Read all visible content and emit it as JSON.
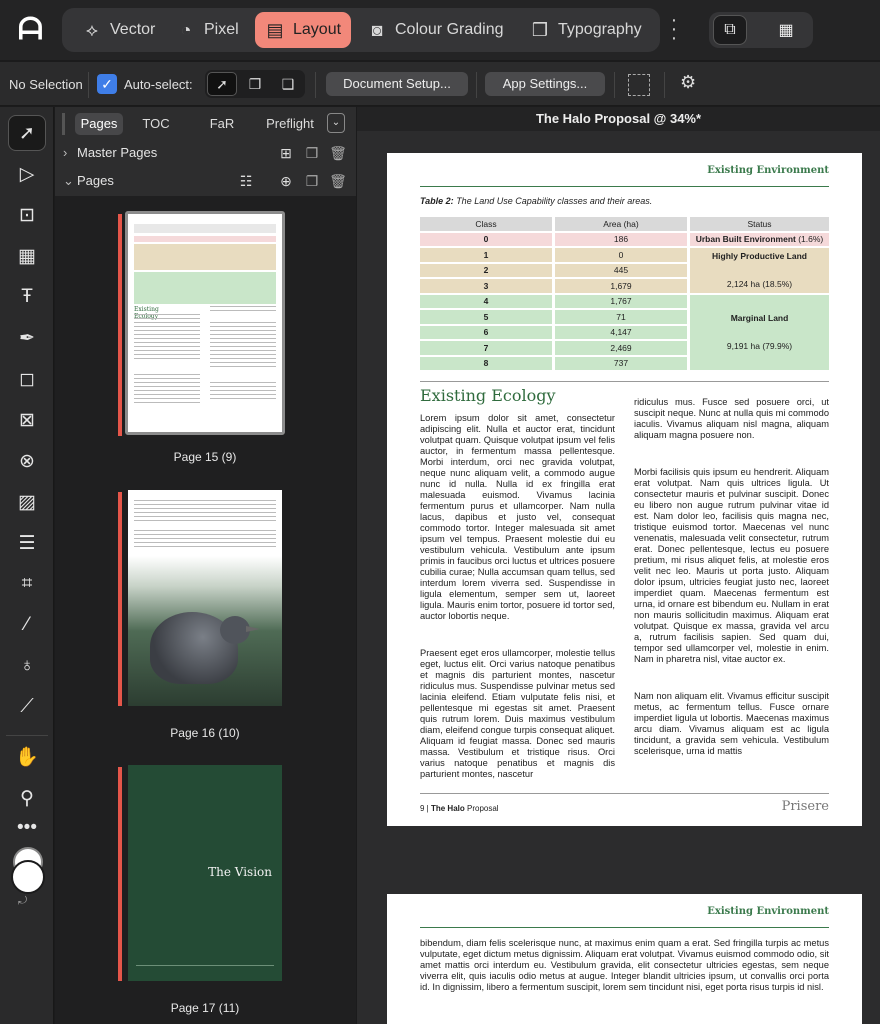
{
  "app": {
    "logo": "affinity-logo"
  },
  "personas": [
    "Vector",
    "Pixel",
    "Layout",
    "Colour Grading",
    "Typography"
  ],
  "context": {
    "selection": "No Selection",
    "auto_select": "Auto-select:",
    "document_setup": "Document Setup...",
    "app_settings": "App Settings..."
  },
  "panel": {
    "tabs": [
      "Pages",
      "TOC",
      "FaR",
      "Preflight"
    ],
    "master_pages": "Master Pages",
    "pages": "Pages",
    "thumbs": [
      {
        "label": "Page 15 (9)"
      },
      {
        "label": "Page 16 (10)"
      },
      {
        "label": "Page 17 (11)",
        "cover_title": "The Vision"
      }
    ]
  },
  "document": {
    "title": "The Halo Proposal @ 34%*",
    "header": "Existing Environment",
    "caption_bold": "Table 2:",
    "caption": " The Land Use Capability classes and their areas.",
    "table": {
      "headers": [
        "Class",
        "Area (ha)",
        "Status"
      ],
      "rows": [
        {
          "class": "0",
          "area": "186"
        },
        {
          "class": "1",
          "area": "0"
        },
        {
          "class": "2",
          "area": "445"
        },
        {
          "class": "3",
          "area": "1,679"
        },
        {
          "class": "4",
          "area": "1,767"
        },
        {
          "class": "5",
          "area": "71"
        },
        {
          "class": "6",
          "area": "4,147"
        },
        {
          "class": "7",
          "area": "2,469"
        },
        {
          "class": "8",
          "area": "737"
        }
      ],
      "status_urban": "Urban Built Environment",
      "status_urban_pct": " (1.6%)",
      "status_hp": "Highly Productive Land",
      "status_hp_area": "2,124 ha (18.5%)",
      "status_marginal": "Marginal Land",
      "status_marginal_area": "9,191 ha (79.9%)"
    },
    "section_title": "Existing Ecology",
    "col1_p1": "Lorem ipsum dolor sit amet, consectetur adipiscing elit. Nulla et auctor erat, tincidunt volutpat quam. Quisque volutpat ipsum vel felis auctor, in fermentum massa pellentesque. Morbi interdum, orci nec gravida volutpat, neque nunc aliquam velit, a commodo augue nunc id nulla. Nulla id ex fringilla erat malesuada euismod. Vivamus lacinia fermentum purus et ullamcorper. Nam nulla lacus, dapibus et justo vel, consequat commodo tortor. Integer malesuada sit amet ipsum vel tempus. Praesent molestie dui eu vestibulum vehicula. Vestibulum ante ipsum primis in faucibus orci luctus et ultrices posuere cubilia curae; Nulla accumsan quam tellus, sed interdum lorem viverra sed. Suspendisse in ligula elementum, semper sem ut, laoreet ligula. Mauris enim tortor, posuere id tortor sed, auctor lobortis neque.",
    "col1_p2": "Praesent eget eros ullamcorper, molestie tellus eget, luctus elit. Orci varius natoque penatibus et magnis dis parturient montes, nascetur ridiculus mus. Suspendisse pulvinar metus sed lacinia eleifend. Etiam vulputate felis nisi, et pellentesque mi egestas sit amet. Praesent quis rutrum lorem. Duis maximus vestibulum diam, eleifend congue turpis consequat aliquet. Aliquam id feugiat massa. Donec sed mauris massa. Vestibulum et tristique risus. Orci varius natoque penatibus et magnis dis parturient montes, nascetur",
    "col2_p1": "ridiculus mus. Fusce sed posuere orci, ut suscipit neque. Nunc at nulla quis mi commodo iaculis. Vivamus aliquam nisl magna, aliquam aliquam magna posuere non.",
    "col2_p2": "Morbi facilisis quis ipsum eu hendrerit. Aliquam erat volutpat. Nam quis ultrices ligula. Ut consectetur mauris et pulvinar suscipit. Donec eu libero non augue rutrum pulvinar vitae id est. Nam dolor leo, facilisis quis magna nec, tristique euismod tortor. Maecenas vel nunc venenatis, malesuada velit consectetur, rutrum erat. Donec pellentesque, lectus eu posuere pretium, mi risus aliquet felis, at molestie eros velit nec leo. Mauris ut porta justo. Aliquam dolor ipsum, ultricies feugiat justo nec, laoreet imperdiet quam. Maecenas fermentum est urna, id ornare est bibendum eu. Nullam in erat non mauris sollicitudin maximus. Aliquam erat volutpat. Quisque ex massa, gravida vel arcu a, rutrum facilisis sapien. Sed quam dui, tempor sed ullamcorper vel, molestie in enim. Nam in pharetra nisl, vitae auctor ex.",
    "col2_p3": "Nam non aliquam elit. Vivamus efficitur suscipit metus, ac fermentum tellus. Fusce ornare imperdiet ligula ut lobortis. Maecenas maximus arcu diam. Vivamus aliquam est ac ligula tincidunt, a gravida sem vehicula. Vestibulum scelerisque, urna id mattis",
    "footer_num": "9 | ",
    "footer_bold": "The Halo",
    "footer_rest": " Proposal",
    "footer_logo": "Prisere",
    "page2_text": "bibendum, diam felis scelerisque nunc, at maximus enim quam a erat. Sed fringilla turpis ac metus vulputate, eget dictum metus dignissim. Aliquam erat volutpat. Vivamus euismod commodo odio, sit amet mattis orci interdum eu. Vestibulum gravida, elit consectetur ultricies egestas, sem neque viverra elit, quis iaculis odio metus at augue. Integer blandit ultricies ipsum, ut convallis orci porta id. In dignissim, libero a fermentum suscipit, lorem sem tincidunt nisi, eget porta risus turpis id nisl."
  },
  "colors": {
    "accent": "#f2887a",
    "green": "#3b7a4c",
    "urban": "#f5d9da",
    "productive": "#e8dcc0",
    "marginal": "#c9e6c9"
  }
}
